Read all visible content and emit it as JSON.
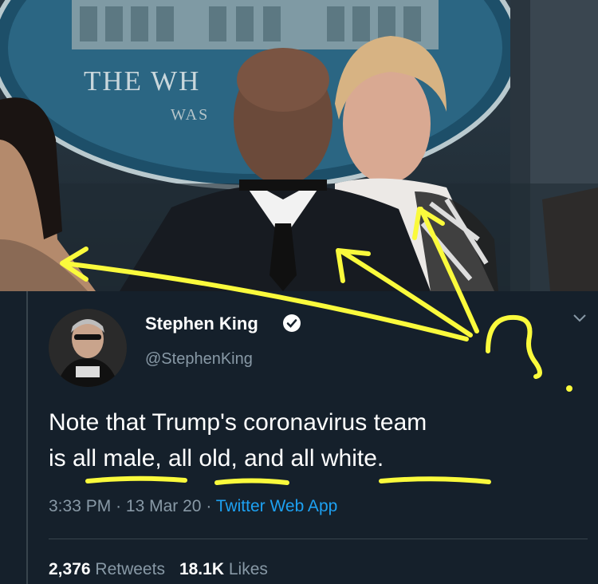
{
  "photo": {
    "seal_line1": "THE WH",
    "seal_line2": "WAS"
  },
  "tweet": {
    "display_name": "Stephen King",
    "handle": "@StephenKing",
    "text_line1": "Note that Trump's coronavirus team",
    "text_line2_parts": [
      "is ",
      "all male",
      ", ",
      "all old",
      ", and ",
      "all white",
      "."
    ],
    "time": "3:33 PM",
    "date": "13 Mar 20",
    "source": "Twitter Web App",
    "retweet_count": "2,376",
    "retweet_label": "Retweets",
    "like_count": "18.1K",
    "like_label": "Likes"
  },
  "annotation": {
    "scribble_mark": "?"
  },
  "colors": {
    "background": "#15202b",
    "secondary_text": "#8899a6",
    "link_blue": "#1da1f2",
    "annotation_yellow": "#fafa3c"
  }
}
